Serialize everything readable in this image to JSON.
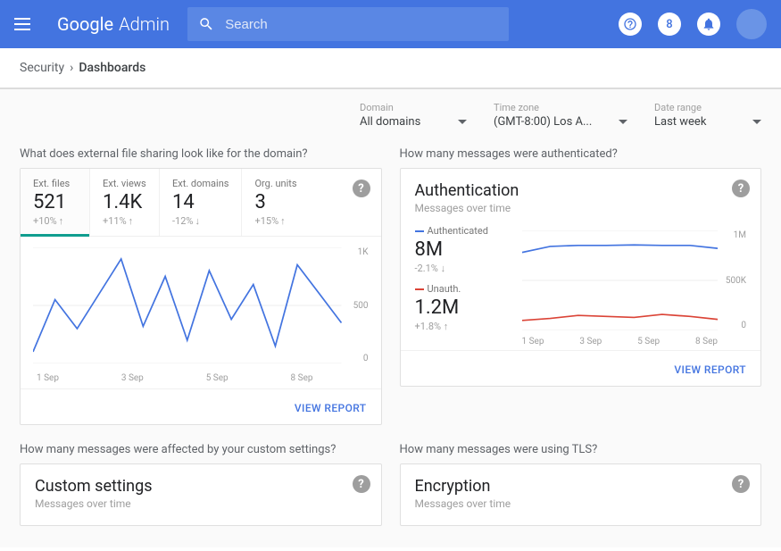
{
  "topbar": {
    "logo_google": "Google",
    "logo_admin": "Admin",
    "search_placeholder": "Search",
    "icon_person_letter": "8"
  },
  "breadcrumb": {
    "parent": "Security",
    "current": "Dashboards"
  },
  "filters": {
    "domain": {
      "label": "Domain",
      "value": "All domains"
    },
    "timezone": {
      "label": "Time zone",
      "value": "(GMT-8:00) Los A..."
    },
    "daterange": {
      "label": "Date range",
      "value": "Last week"
    }
  },
  "cards": {
    "external_sharing": {
      "section_title": "What does external file sharing look like for the domain?",
      "tabs": [
        {
          "label": "Ext. files",
          "value": "521",
          "delta": "+10%",
          "dir": "up"
        },
        {
          "label": "Ext. views",
          "value": "1.4K",
          "delta": "+11%",
          "dir": "up"
        },
        {
          "label": "Ext. domains",
          "value": "14",
          "delta": "-12%",
          "dir": "down"
        },
        {
          "label": "Org. units",
          "value": "3",
          "delta": "+15%",
          "dir": "up"
        }
      ],
      "view_report": "VIEW REPORT"
    },
    "authentication": {
      "section_title": "How many messages were authenticated?",
      "title": "Authentication",
      "subtitle": "Messages over time",
      "series": [
        {
          "name": "Authenticated",
          "value": "8M",
          "delta": "-2.1%",
          "dir": "down",
          "color": "#4374e0"
        },
        {
          "name": "Unauth.",
          "value": "1.2M",
          "delta": "+1.8%",
          "dir": "up",
          "color": "#db4437"
        }
      ],
      "view_report": "VIEW REPORT"
    },
    "custom_settings": {
      "section_title": "How many messages were affected by your custom settings?",
      "title": "Custom settings",
      "subtitle": "Messages over time"
    },
    "encryption": {
      "section_title": "How many messages were using TLS?",
      "title": "Encryption",
      "subtitle": "Messages over time"
    }
  },
  "chart_data": [
    {
      "id": "external_sharing",
      "type": "line",
      "x": [
        1,
        2,
        3,
        4,
        5,
        6,
        7,
        8
      ],
      "x_tick_labels": [
        "1 Sep",
        "3 Sep",
        "5 Sep",
        "8 Sep"
      ],
      "y_ticks": [
        "1K",
        "500",
        "0"
      ],
      "ylim": [
        0,
        1000
      ],
      "series": [
        {
          "name": "Ext. files",
          "color": "#4374e0",
          "values": [
            100,
            550,
            300,
            600,
            900,
            320,
            750,
            200,
            800,
            380,
            680,
            150,
            850,
            600,
            350
          ]
        }
      ]
    },
    {
      "id": "authentication",
      "type": "line",
      "x": [
        1,
        2,
        3,
        4,
        5,
        6,
        7,
        8
      ],
      "x_tick_labels": [
        "1 Sep",
        "3 Sep",
        "5 Sep",
        "8 Sep"
      ],
      "y_ticks": [
        "1M",
        "500K",
        "0"
      ],
      "ylim": [
        0,
        1000000
      ],
      "series": [
        {
          "name": "Authenticated",
          "color": "#4374e0",
          "values": [
            780000,
            840000,
            850000,
            850000,
            855000,
            850000,
            850000,
            820000
          ]
        },
        {
          "name": "Unauth.",
          "color": "#db4437",
          "values": [
            100000,
            120000,
            150000,
            140000,
            130000,
            160000,
            140000,
            110000
          ]
        }
      ]
    }
  ]
}
